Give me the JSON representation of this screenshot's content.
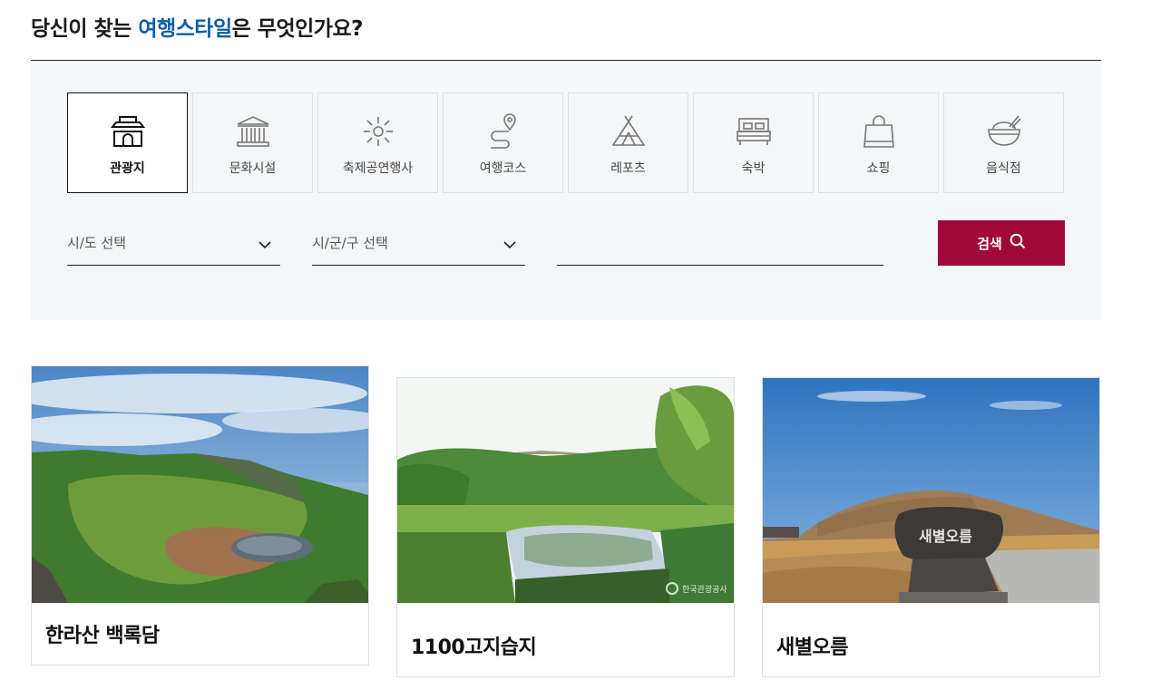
{
  "heading": {
    "prefix": "당신이 찾는 ",
    "accent": "여행스타일",
    "suffix": "은 무엇인가요?"
  },
  "categories": [
    {
      "label": "관광지",
      "icon": "palace-gate-icon",
      "active": true
    },
    {
      "label": "문화시설",
      "icon": "museum-building-icon",
      "active": false
    },
    {
      "label": "축제공연행사",
      "icon": "firework-icon",
      "active": false
    },
    {
      "label": "여행코스",
      "icon": "route-pin-icon",
      "active": false
    },
    {
      "label": "레포츠",
      "icon": "tent-icon",
      "active": false
    },
    {
      "label": "숙박",
      "icon": "bed-icon",
      "active": false
    },
    {
      "label": "쇼핑",
      "icon": "shopping-bag-icon",
      "active": false
    },
    {
      "label": "음식점",
      "icon": "rice-bowl-icon",
      "active": false
    }
  ],
  "filters": {
    "province_label": "시/도 선택",
    "district_label": "시/군/구 선택",
    "keyword_value": "",
    "search_label": "검색"
  },
  "cards": [
    {
      "title": "한라산 백록담",
      "photo": "crater-lake-photo"
    },
    {
      "title": "1100고지습지",
      "photo": "wetland-pond-photo",
      "watermark": "한국관광공사"
    },
    {
      "title": "새별오름",
      "photo": "oreum-stone-photo",
      "stone_text": "새별오름"
    }
  ],
  "colors": {
    "accent": "#0b5ea8",
    "button": "#a1083a",
    "panel": "#f4f6f8"
  }
}
